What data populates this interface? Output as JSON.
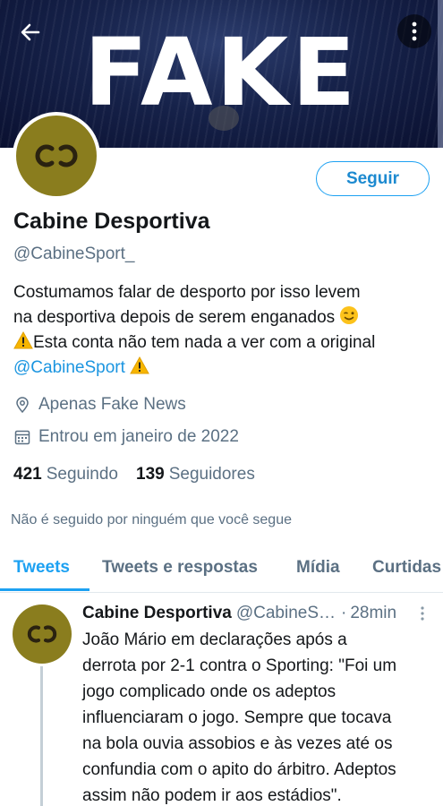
{
  "header": {
    "banner_text": "FAKE",
    "back_icon": "arrow-left-icon",
    "menu_icon": "more-vertical-icon"
  },
  "profile": {
    "name": "Cabine Desportiva",
    "handle": "@CabineSport_",
    "follow_label": "Seguir",
    "bio_lines": [
      "Costumamos falar de desporto por isso levem",
      "na desportiva depois de serem enganados",
      "Esta conta não tem nada a ver com a original",
      "@CabineSport"
    ],
    "location": "Apenas Fake News",
    "joined": "Entrou em janeiro de 2022",
    "following_count": "421",
    "following_label": "Seguindo",
    "followers_count": "139",
    "followers_label": "Seguidores",
    "not_followed": "Não é seguido por ninguém que você segue"
  },
  "tabs": [
    {
      "label": "Tweets",
      "active": true
    },
    {
      "label": "Tweets e respostas",
      "active": false
    },
    {
      "label": "Mídia",
      "active": false
    },
    {
      "label": "Curtidas",
      "active": false
    }
  ],
  "tweet": {
    "author": "Cabine Desportiva",
    "handle": "@CabineS…",
    "separator": "·",
    "time": "28min",
    "body_lines": [
      "João Mário em declarações após a",
      "derrota por 2-1 contra o Sporting: \"Foi um",
      "jogo complicado onde os adeptos",
      "influenciaram o jogo. Sempre que tocava",
      "na bola ouvia assobios e às vezes até os",
      "confundia com o apito do árbitro. Adeptos",
      "assim não podem ir aos estádios\"."
    ]
  },
  "colors": {
    "accent": "#1da1f2",
    "secondary_text": "#5b7083",
    "avatar_bg": "#8a7d1e"
  }
}
